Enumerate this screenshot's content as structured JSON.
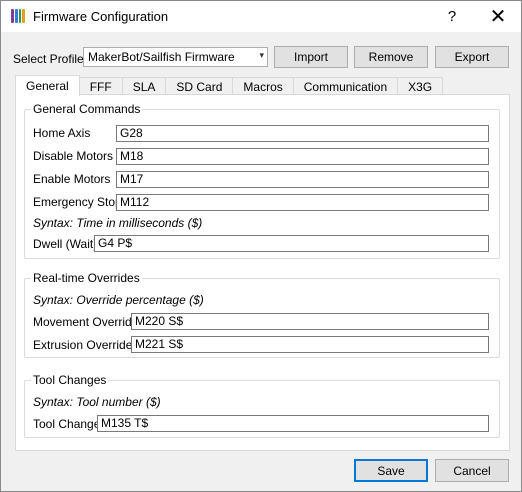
{
  "window": {
    "title": "Firmware Configuration",
    "help_glyph": "?",
    "close_glyph": "✕",
    "icon_colors": [
      "#7b3f9e",
      "#3a7bd5",
      "#2e9a47",
      "#e0a020"
    ]
  },
  "profile": {
    "label": "Select Profile:",
    "selected": "MakerBot/Sailfish Firmware",
    "arrow": "▾"
  },
  "buttons": {
    "import": "Import",
    "remove": "Remove",
    "export": "Export",
    "save": "Save",
    "cancel": "Cancel"
  },
  "tabs": [
    "General",
    "FFF",
    "SLA",
    "SD Card",
    "Macros",
    "Communication",
    "X3G"
  ],
  "general": {
    "title": "General Commands",
    "home_axis": {
      "label": "Home Axis",
      "value": "G28"
    },
    "disable_motors": {
      "label": "Disable Motors",
      "value": "M18"
    },
    "enable_motors": {
      "label": "Enable Motors",
      "value": "M17"
    },
    "emergency_stop": {
      "label": "Emergency Stop",
      "value": "M112"
    },
    "syntax": "Syntax: Time in milliseconds ($)",
    "dwell": {
      "label": "Dwell (Wait)",
      "value": "G4 P$"
    }
  },
  "realtime": {
    "title": "Real-time Overrides",
    "syntax": "Syntax: Override percentage ($)",
    "movement": {
      "label": "Movement Override",
      "value": "M220 S$"
    },
    "extrusion": {
      "label": "Extrusion Override",
      "value": "M221 S$"
    }
  },
  "tool": {
    "title": "Tool Changes",
    "syntax": "Syntax: Tool number ($)",
    "change": {
      "label": "Tool Change",
      "value": "M135 T$"
    }
  }
}
